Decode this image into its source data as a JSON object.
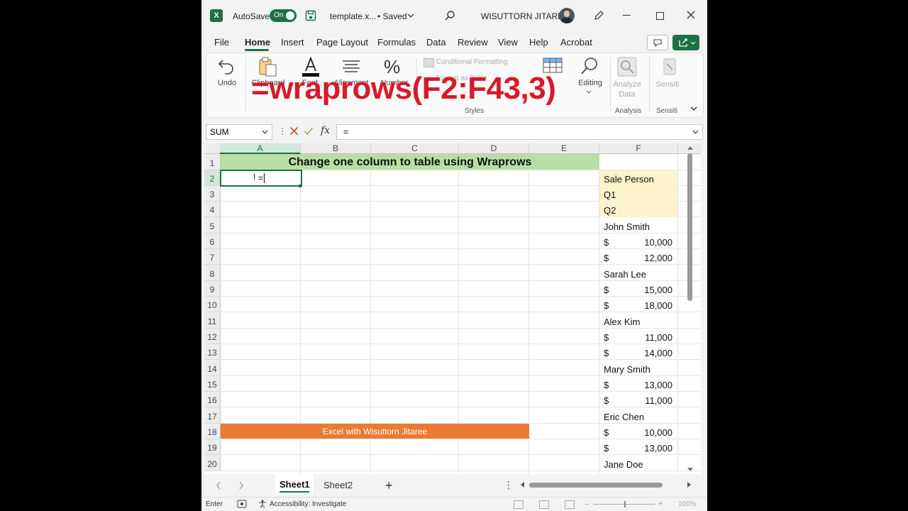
{
  "titlebar": {
    "autosave_label": "AutoSave",
    "autosave_state": "On",
    "filename": "template.x...",
    "save_status": "• Saved",
    "user_name": "WISUTTORN JITAREE"
  },
  "menu": {
    "items": [
      "File",
      "Home",
      "Insert",
      "Page Layout",
      "Formulas",
      "Data",
      "Review",
      "View",
      "Help",
      "Acrobat"
    ],
    "active": "Home"
  },
  "ribbon": {
    "undo": "Undo",
    "clipboard": "Clipboard",
    "font": "Font",
    "alignment": "Alignment",
    "number": "Number",
    "conditional_formatting": "Conditional Formatting",
    "format_as_table": "Format as Table",
    "styles": "Styles",
    "editing": "Editing",
    "analyze_data_1": "Analyze",
    "analyze_data_2": "Data",
    "analysis": "Analysis",
    "sensitivity": "Sensiti",
    "sensitivity_group": "Sensiti"
  },
  "overlay": {
    "formula": "=wraprows(F2:F43,3)"
  },
  "formula_bar": {
    "name_box": "SUM",
    "fx": "fx",
    "content": "="
  },
  "grid": {
    "columns": [
      "A",
      "B",
      "C",
      "D",
      "E",
      "F"
    ],
    "rows": [
      "1",
      "2",
      "3",
      "4",
      "5",
      "6",
      "7",
      "8",
      "9",
      "10",
      "11",
      "12",
      "13",
      "14",
      "15",
      "16",
      "17",
      "18",
      "19",
      "20"
    ],
    "title": "Change one column to table using Wraprows",
    "active_cell_text": "=",
    "banner": "Excel with Wisuttorn Jitaree",
    "col_f": [
      {
        "text": "Sale Person"
      },
      {
        "text": "Q1"
      },
      {
        "text": "Q2"
      },
      {
        "text": "John Smith"
      },
      {
        "cur": "$",
        "amt": "10,000"
      },
      {
        "cur": "$",
        "amt": "12,000"
      },
      {
        "text": "Sarah Lee"
      },
      {
        "cur": "$",
        "amt": "15,000"
      },
      {
        "cur": "$",
        "amt": "18,000"
      },
      {
        "text": "Alex Kim"
      },
      {
        "cur": "$",
        "amt": "11,000"
      },
      {
        "cur": "$",
        "amt": "14,000"
      },
      {
        "text": "Mary Smith"
      },
      {
        "cur": "$",
        "amt": "13,000"
      },
      {
        "cur": "$",
        "amt": "11,000"
      },
      {
        "text": "Eric Chen"
      },
      {
        "cur": "$",
        "amt": "10,000"
      },
      {
        "cur": "$",
        "amt": "13,000"
      },
      {
        "text": "Jane Doe"
      }
    ]
  },
  "sheets": {
    "tabs": [
      "Sheet1",
      "Sheet2"
    ],
    "active": "Sheet1"
  },
  "status": {
    "mode": "Enter",
    "accessibility": "Accessibility: Investigate",
    "zoom": "100%"
  },
  "colors": {
    "excel_green": "#1e7145",
    "title_fill": "#b7dfa4",
    "header_fill": "#fdf3cd",
    "banner_fill": "#e97b33",
    "overlay_red": "#d61a2b"
  }
}
